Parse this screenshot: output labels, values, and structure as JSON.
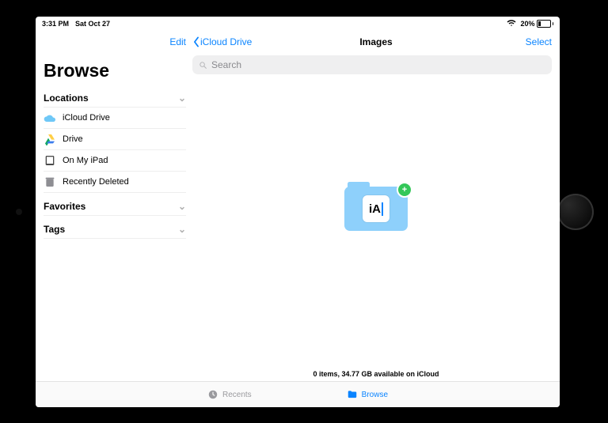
{
  "status": {
    "time": "3:31 PM",
    "date": "Sat Oct 27",
    "battery": "20%"
  },
  "header": {
    "edit": "Edit",
    "back": "iCloud Drive",
    "title": "Images",
    "select": "Select"
  },
  "sidebar": {
    "title": "Browse",
    "sections": {
      "locations": {
        "label": "Locations",
        "items": [
          {
            "label": "iCloud Drive",
            "icon": "icloud"
          },
          {
            "label": "Drive",
            "icon": "gdrive"
          },
          {
            "label": "On My iPad",
            "icon": "ipad"
          },
          {
            "label": "Recently Deleted",
            "icon": "trash"
          }
        ]
      },
      "favorites": {
        "label": "Favorites"
      },
      "tags": {
        "label": "Tags"
      }
    }
  },
  "search": {
    "placeholder": "Search"
  },
  "stage": {
    "folder_label": "iA",
    "badge": "+"
  },
  "footer": {
    "info": "0 items, 34.77 GB available on iCloud"
  },
  "tabs": {
    "recents": "Recents",
    "browse": "Browse"
  }
}
